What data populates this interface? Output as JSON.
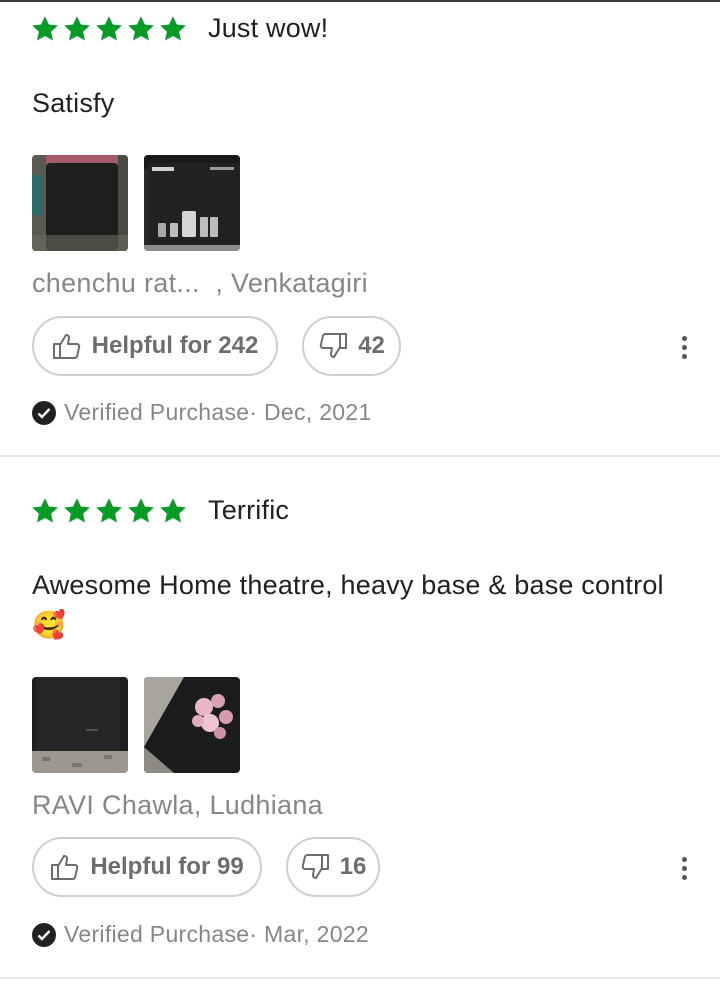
{
  "colors": {
    "star": "#0a9a27",
    "muted": "#878787",
    "text": "#212121"
  },
  "reviews": [
    {
      "rating": 5,
      "title": "Just wow!",
      "body": "Satisfy",
      "emoji": "",
      "photos": [
        "speaker-photo",
        "home-theatre-box-photo"
      ],
      "author": "chenchu rat...  , Venkatagiri",
      "helpful_label": "Helpful for 242",
      "unhelpful_count": "42",
      "verified": "Verified Purchase",
      "date": "· Dec, 2021"
    },
    {
      "rating": 5,
      "title": "Terrific",
      "body": "Awesome Home theatre, heavy base & base control",
      "emoji": "🥰",
      "photos": [
        "subwoofer-photo",
        "flowers-photo"
      ],
      "author": "RAVI Chawla, Ludhiana",
      "helpful_label": "Helpful for 99",
      "unhelpful_count": "16",
      "verified": "Verified Purchase",
      "date": "· Mar, 2022"
    }
  ]
}
